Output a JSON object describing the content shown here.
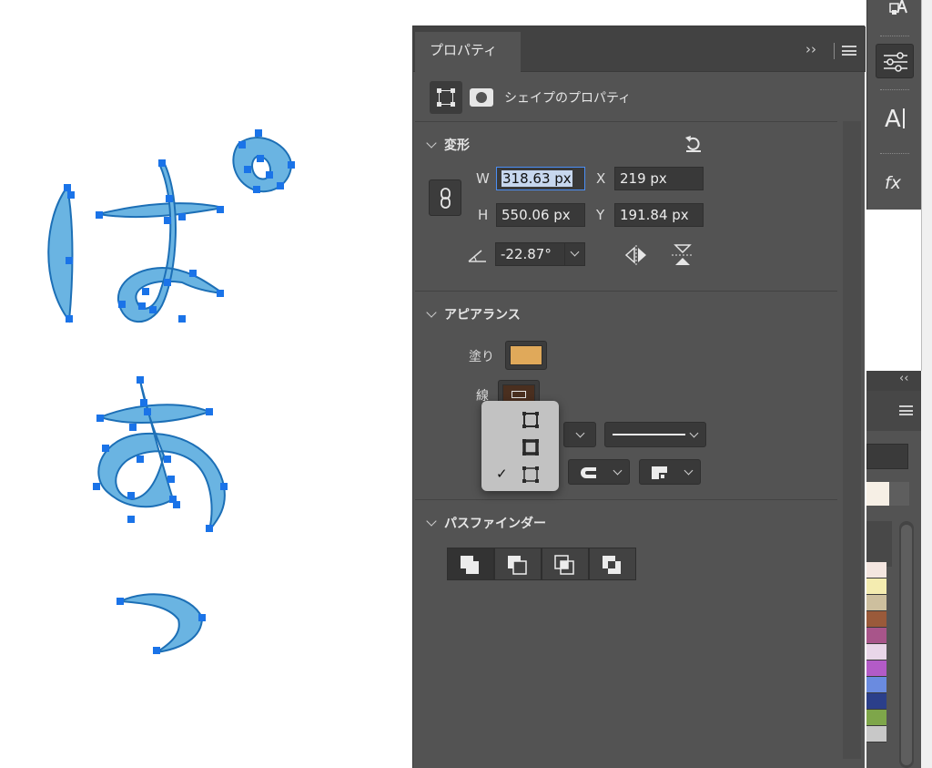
{
  "panel": {
    "tab_label": "プロパティ",
    "expand_glyph": "››",
    "shape_properties_title": "シェイプのプロパティ",
    "transform": {
      "title": "変形",
      "w_label": "W",
      "w_value": "318.63 px",
      "h_label": "H",
      "h_value": "550.06 px",
      "x_label": "X",
      "x_value": "219 px",
      "y_label": "Y",
      "y_value": "191.84 px",
      "angle_value": "-22.87°"
    },
    "appearance": {
      "title": "アピアランス",
      "fill_label": "塗り",
      "fill_color": "#e0a95a",
      "stroke_label": "線",
      "stroke_color": "#4a2f1f"
    },
    "pathfinder": {
      "title": "パスファインダー"
    }
  },
  "stroke_align_menu": {
    "items": [
      {
        "icon": "stroke-align-inside-icon",
        "checked": false
      },
      {
        "icon": "stroke-align-center-icon",
        "checked": false
      },
      {
        "icon": "stroke-align-outside-icon",
        "checked": true
      }
    ],
    "check_glyph": "✓"
  },
  "toolstrip": {
    "character_glyph": "A",
    "fx_glyph": "fx"
  },
  "dock2": {
    "collapse_glyph": "‹‹",
    "palette": [
      "#f4e6e0",
      "#f4ecb0",
      "#cdbf9e",
      "#9a5a3a",
      "#a8558a",
      "#e9d6e9",
      "#b35bc7",
      "#6a8be0",
      "#2b3f8a",
      "#7ea64a",
      "#c8c8c8"
    ]
  },
  "canvas": {
    "shape_fill": "#6ab4e2",
    "shape_stroke": "#1c6fb6",
    "anchor_color": "#1a73e8"
  }
}
